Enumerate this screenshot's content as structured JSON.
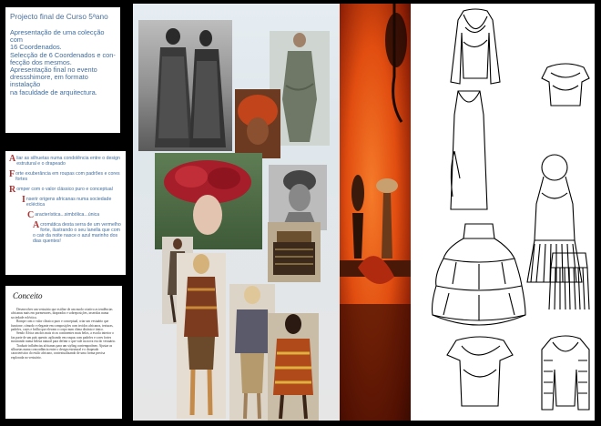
{
  "intro": {
    "title": "Projecto final de Curso 5ªano",
    "lines": [
      "Apresentação de uma colecção com",
      "16 Coordenados.",
      "Selecção de 6 Coordenados e con-",
      "fecção dos mesmos.",
      "Apresentação final no evento",
      "dressshimore, em formato instalação",
      "na faculdade de arquitectura."
    ]
  },
  "keywords": [
    {
      "initial": "A",
      "text": "liar as silhuetas numa condolência entre o design estrutural e o drapeado"
    },
    {
      "initial": "F",
      "text": "orte exuberância em roupas com padrões e cores fortes"
    },
    {
      "initial": "R",
      "text": "omper com o valor clássico puro e conceptual"
    },
    {
      "initial": "I",
      "text": "nserir origens africanas numa sociedade ecléctica"
    },
    {
      "initial": "C",
      "text": "aracterística...simbólica...única"
    },
    {
      "initial": "A",
      "text": "cromática desta serra de um vermelho forte, ilustrando o seu lanella que com o cair da noite nasce o azul marinho dos dias quentes!"
    }
  ],
  "concept": {
    "heading": "Conceito",
    "paragraphs": [
      "Desenvolver um vestuário que estilize de um modo criativo as tendências africanas mais em pormenores, drapeados e sobreposições, inseridas numa sociedade ecléctica.",
      "Rompe com o valor clássico puro e conceptual, criar um vestuário que funcione, cómodo e elegante em composições com tecidos africanos, texturas, padrões, cores e brilho que elevam o corpo num clima distinto e único.",
      "Sendo África um dos mais ricos continentes mais belos, a escola interior o faz parte de um país quente, aplicando em roupas com padrões e cores fortes mostrando numa beleza natural para definir o que vale na nova era do vestuário.",
      "Traduzir influências africanas para um styling contemporâneo. Ajustar as silhuetas numa concordância entre o design estrutural e o drapeado característico do estilo africano, contextualizando de uma forma precisa explorada no vestuário."
    ]
  },
  "colors": {
    "text_blue": "#3f6c9d",
    "initial_red": "#a33333",
    "orange_bg": "#e14d10",
    "sketch_bg": "#ffffff"
  }
}
